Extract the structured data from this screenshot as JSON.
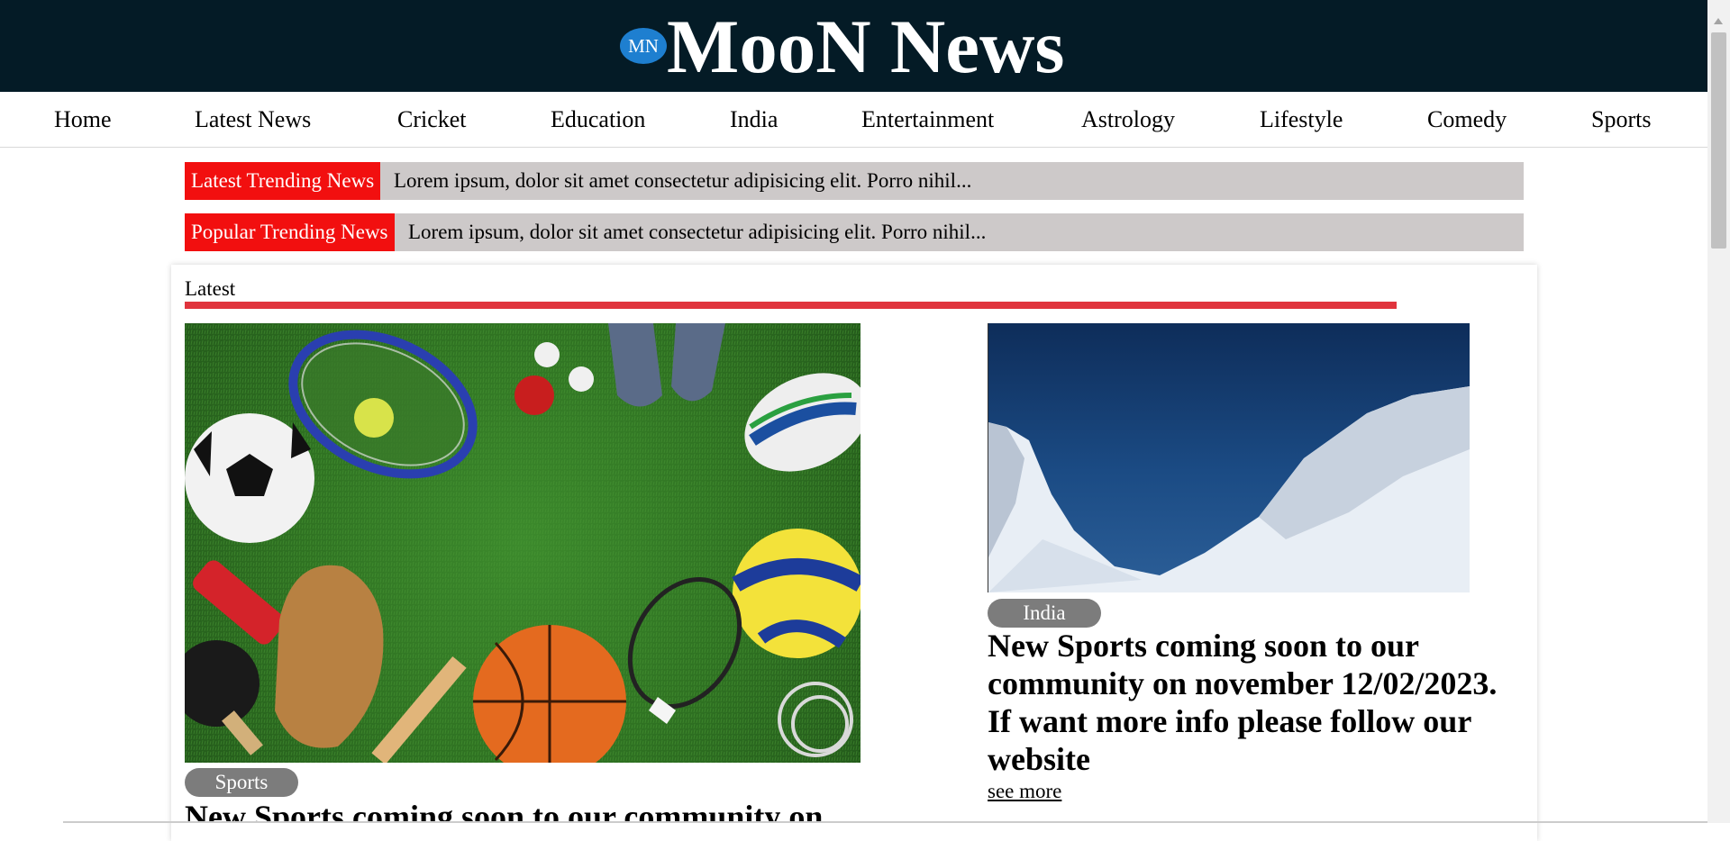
{
  "header": {
    "logo_badge": "MN",
    "site_title": "MooN News"
  },
  "nav": {
    "items": [
      {
        "label": "Home"
      },
      {
        "label": "Latest News"
      },
      {
        "label": "Cricket"
      },
      {
        "label": "Education"
      },
      {
        "label": "India"
      },
      {
        "label": "Entertainment"
      },
      {
        "label": "Astrology"
      },
      {
        "label": "Lifestyle"
      },
      {
        "label": "Comedy"
      },
      {
        "label": "Sports"
      }
    ]
  },
  "tickers": [
    {
      "tag": "Latest Trending News",
      "text": "Lorem ipsum, dolor sit amet consectetur adipisicing elit. Porro nihil..."
    },
    {
      "tag": "Popular Trending News",
      "text": "Lorem ipsum, dolor sit amet consectetur adipisicing elit. Porro nihil..."
    }
  ],
  "latest": {
    "section_title": "Latest",
    "left_article": {
      "tag": "Sports",
      "headline": "New Sports coming soon to our community on"
    },
    "right_article": {
      "tag": "India",
      "headline": "New Sports coming soon to our community on november 12/02/2023. If want more info please follow our website",
      "see_more": "see more"
    }
  },
  "colors": {
    "header_bg": "#041b26",
    "badge": "#1e7fd0",
    "ticker_tag": "#f20f0f",
    "ticker_bg": "#cdc9c9",
    "section_rule": "#e0343d",
    "tag_pill": "#7c7c7c"
  }
}
